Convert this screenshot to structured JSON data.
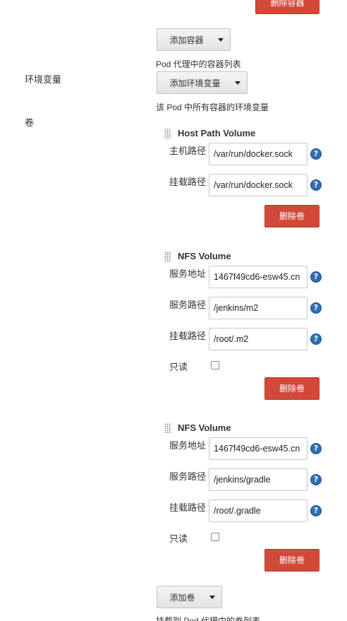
{
  "top": {
    "delete_container_label": "删除容器"
  },
  "containers": {
    "add_button_label": "添加容器",
    "help_text": "Pod 代理中的容器列表"
  },
  "env": {
    "section_label": "环境变量",
    "add_button_label": "添加环境变量",
    "help_text": "该 Pod 中所有容器的环境变量"
  },
  "volumes": {
    "section_label": "卷",
    "help_icon_glyph": "?",
    "items": [
      {
        "title": "Host Path Volume",
        "fields": [
          {
            "label": "主机路径",
            "value": "/var/run/docker.sock"
          },
          {
            "label": "挂载路径",
            "value": "/var/run/docker.sock"
          }
        ],
        "delete_label": "删除卷"
      },
      {
        "title": "NFS Volume",
        "fields": [
          {
            "label": "服务地址",
            "value": "1467f49cd6-esw45.cn"
          },
          {
            "label": "服务路径",
            "value": "/jenkins/m2"
          },
          {
            "label": "挂载路径",
            "value": "/root/.m2"
          }
        ],
        "readonly_label": "只读",
        "readonly_checked": false,
        "delete_label": "删除卷"
      },
      {
        "title": "NFS Volume",
        "fields": [
          {
            "label": "服务地址",
            "value": "1467f49cd6-esw45.cn"
          },
          {
            "label": "服务路径",
            "value": "/jenkins/gradle"
          },
          {
            "label": "挂载路径",
            "value": "/root/.gradle"
          }
        ],
        "readonly_label": "只读",
        "readonly_checked": false,
        "delete_label": "删除卷"
      }
    ],
    "add_button_label": "添加卷",
    "help_text": "挂载到 Pod 代理中的卷列表"
  },
  "colors": {
    "danger": "#d24939",
    "help_icon": "#2e6db5",
    "button_gray": "#e8e8e8"
  }
}
